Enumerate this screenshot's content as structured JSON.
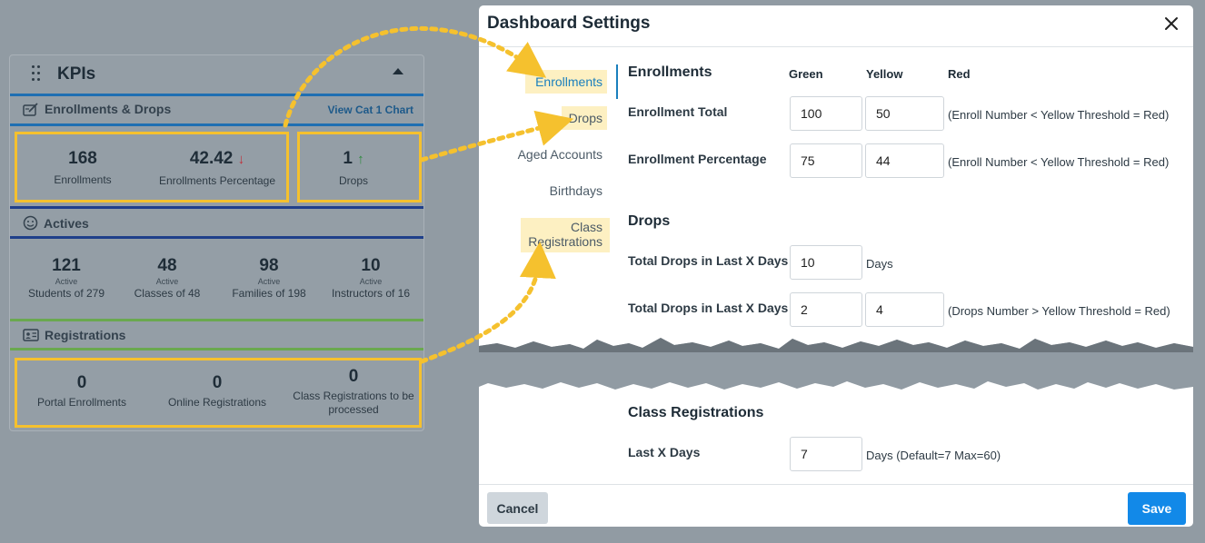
{
  "kpi": {
    "title": "KPIs",
    "enrollments_section": {
      "label": "Enrollments & Drops",
      "link": "View Cat 1 Chart",
      "stats": [
        {
          "value": "168",
          "label": "Enrollments"
        },
        {
          "value": "42.42",
          "trend": "↓",
          "label": "Enrollments Percentage"
        },
        {
          "value": "1",
          "trend": "↑",
          "label": "Drops"
        }
      ]
    },
    "actives_section": {
      "label": "Actives",
      "stats": [
        {
          "value": "121",
          "sub": "Active",
          "label": "Students of 279"
        },
        {
          "value": "48",
          "sub": "Active",
          "label": "Classes of 48"
        },
        {
          "value": "98",
          "sub": "Active",
          "label": "Families of 198"
        },
        {
          "value": "10",
          "sub": "Active",
          "label": "Instructors of 16"
        }
      ]
    },
    "registrations_section": {
      "label": "Registrations",
      "stats": [
        {
          "value": "0",
          "label": "Portal Enrollments"
        },
        {
          "value": "0",
          "label": "Online Registrations"
        },
        {
          "value": "0",
          "label": "Class Registrations to be processed"
        }
      ]
    }
  },
  "modal": {
    "title": "Dashboard Settings",
    "nav": [
      "Enrollments",
      "Drops",
      "Aged Accounts",
      "Birthdays",
      "Class Registrations"
    ],
    "columns": [
      "Green",
      "Yellow",
      "Red"
    ],
    "enrollments": {
      "heading": "Enrollments",
      "rows": [
        {
          "label": "Enrollment Total",
          "green": "100",
          "yellow": "50",
          "hint": "(Enroll Number < Yellow Threshold = Red)"
        },
        {
          "label": "Enrollment Percentage",
          "green": "75",
          "yellow": "44",
          "hint": "(Enroll Number < Yellow Threshold = Red)"
        }
      ]
    },
    "drops": {
      "heading": "Drops",
      "rows": [
        {
          "label": "Total Drops in Last X Days",
          "green": "10",
          "hint": "Days"
        },
        {
          "label": "Total Drops in Last X Days",
          "green": "2",
          "yellow": "4",
          "hint": "(Drops Number > Yellow Threshold = Red)"
        }
      ]
    },
    "class_registrations": {
      "heading": "Class Registrations",
      "rows": [
        {
          "label": "Last X Days",
          "green": "7",
          "hint": "Days (Default=7 Max=60)"
        }
      ]
    },
    "cancel_label": "Cancel",
    "save_label": "Save"
  },
  "colors": {
    "highlight": "#f5c12e",
    "rule_blue": "#1f6fb2",
    "rule_navy": "#1f3f8a",
    "rule_green": "#6aa84f",
    "accent": "#1a7fbd",
    "save": "#1289e8"
  }
}
